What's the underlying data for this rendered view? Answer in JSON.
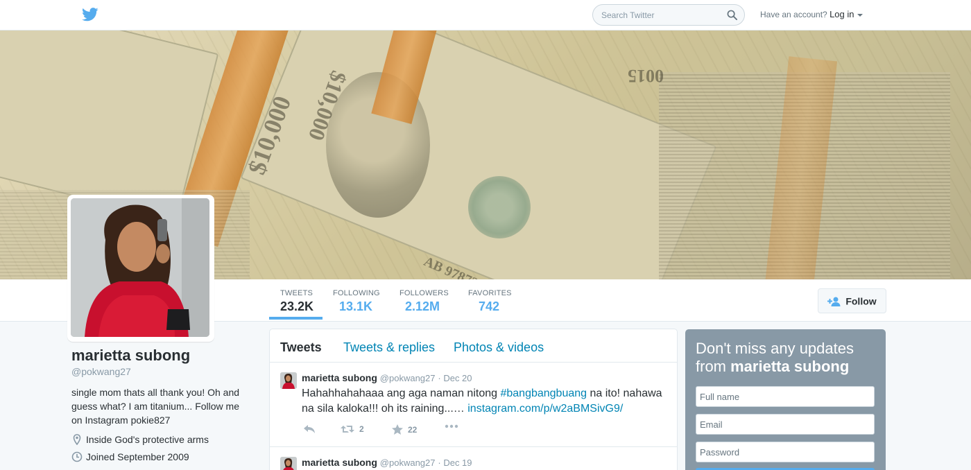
{
  "topbar": {
    "search_placeholder": "Search Twitter",
    "account_prompt": "Have an account?",
    "login_label": "Log in"
  },
  "banner": {
    "texts": [
      "$10,000",
      "$10,000",
      "0015",
      "AB 978725"
    ]
  },
  "stats": [
    {
      "label": "TWEETS",
      "value": "23.2K",
      "active": true
    },
    {
      "label": "FOLLOWING",
      "value": "13.1K"
    },
    {
      "label": "FOLLOWERS",
      "value": "2.12M"
    },
    {
      "label": "FAVORITES",
      "value": "742"
    }
  ],
  "follow_label": "Follow",
  "profile": {
    "name": "marietta subong",
    "handle": "@pokwang27",
    "bio": "single mom thats all thank you! Oh and guess what? I am titanium... Follow me on Instagram pokie827",
    "location": "Inside God's protective arms",
    "joined": "Joined September 2009"
  },
  "timeline": {
    "tabs": [
      "Tweets",
      "Tweets & replies",
      "Photos & videos"
    ],
    "tweets": [
      {
        "name": "marietta subong",
        "handle": "@pokwang27",
        "date": "· Dec 20",
        "text_before": "Hahahhahahaaa ang aga naman nitong ",
        "hashtag": "#bangbangbuang",
        "text_middle": " na ito! nahawa na sila kaloka!!! oh its raining...… ",
        "link": "instagram.com/p/w2aBMSivG9/",
        "retweets": "2",
        "favorites": "22"
      },
      {
        "name": "marietta subong",
        "handle": "@pokwang27",
        "date": "· Dec 19"
      }
    ]
  },
  "signup": {
    "heading_prefix": "Don't miss any updates from",
    "heading_name": "marietta subong",
    "fullname_placeholder": "Full name",
    "email_placeholder": "Email",
    "password_placeholder": "Password"
  },
  "colors": {
    "accent": "#55acee",
    "link": "#0084b4",
    "signup_bg": "#8899a6"
  },
  "icons": [
    "twitter-bird-icon",
    "search-icon",
    "caret-down-icon",
    "follow-user-icon",
    "location-pin-icon",
    "clock-icon",
    "reply-icon",
    "retweet-icon",
    "favorite-star-icon",
    "more-icon"
  ]
}
